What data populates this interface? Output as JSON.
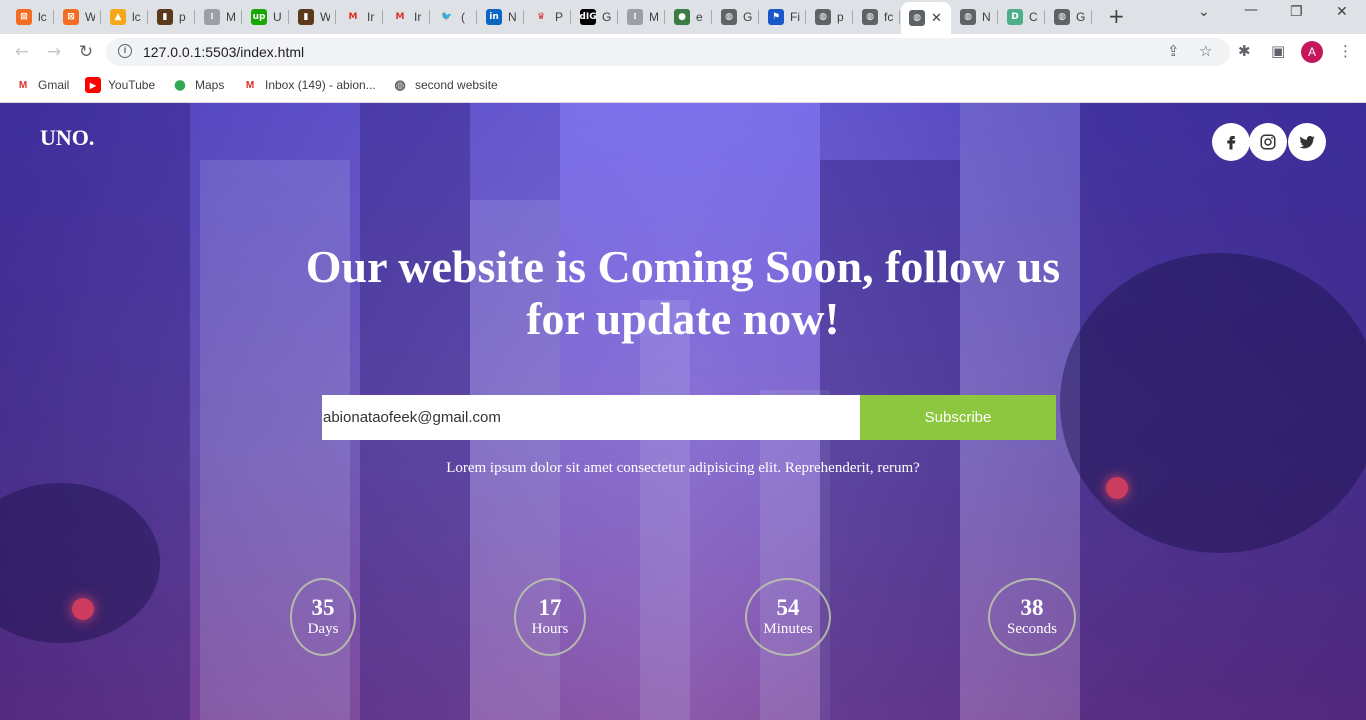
{
  "browser": {
    "tabs": [
      {
        "title": "lc",
        "icon": "xampp-icon",
        "color": "#f26d21",
        "glyph": "⊠"
      },
      {
        "title": "W",
        "icon": "xampp-icon",
        "color": "#f26d21",
        "glyph": "⊠"
      },
      {
        "title": "lc",
        "icon": "phpmyadmin-icon",
        "color": "#f6a81a",
        "glyph": "▲"
      },
      {
        "title": "p",
        "icon": "book-icon",
        "color": "#5a3a1a",
        "glyph": "▮"
      },
      {
        "title": "M",
        "icon": "grid-icon",
        "color": "#9aa0a6",
        "glyph": "⁞"
      },
      {
        "title": "U",
        "icon": "upwork-icon",
        "color": "#14a800",
        "glyph": "up"
      },
      {
        "title": "W",
        "icon": "book-icon",
        "color": "#5a3a1a",
        "glyph": "▮"
      },
      {
        "title": "Ir",
        "icon": "gmail-icon",
        "color": "#ffffff",
        "glyph": "M"
      },
      {
        "title": "Ir",
        "icon": "gmail-icon",
        "color": "#ffffff",
        "glyph": "M"
      },
      {
        "title": "(",
        "icon": "twitter-icon",
        "color": "#ffffff",
        "glyph": "🐦"
      },
      {
        "title": "N",
        "icon": "linkedin-icon",
        "color": "#0a66c2",
        "glyph": "in"
      },
      {
        "title": "P",
        "icon": "premier-league-icon",
        "color": "#ffffff",
        "glyph": "♛"
      },
      {
        "title": "G",
        "icon": "dig-icon",
        "color": "#000000",
        "glyph": "dIG"
      },
      {
        "title": "M",
        "icon": "grid-icon",
        "color": "#9aa0a6",
        "glyph": "⁞"
      },
      {
        "title": "e",
        "icon": "monster-icon",
        "color": "#3a7d44",
        "glyph": "●"
      },
      {
        "title": "G",
        "icon": "globe-icon",
        "color": "#5f6368",
        "glyph": "◍"
      },
      {
        "title": "Fi",
        "icon": "flag-icon",
        "color": "#1a56c7",
        "glyph": "⚑"
      },
      {
        "title": "p",
        "icon": "globe-icon",
        "color": "#5f6368",
        "glyph": "◍"
      },
      {
        "title": "fc",
        "icon": "globe-icon",
        "color": "#5f6368",
        "glyph": "◍"
      },
      {
        "title": "",
        "icon": "globe-icon",
        "color": "#5f6368",
        "glyph": "◍",
        "active": true
      },
      {
        "title": "N",
        "icon": "github-icon",
        "color": "#5f6368",
        "glyph": "◍"
      },
      {
        "title": "C",
        "icon": "d-icon",
        "color": "#4caf8a",
        "glyph": "D"
      },
      {
        "title": "G",
        "icon": "globe-icon",
        "color": "#5f6368",
        "glyph": "◍"
      }
    ],
    "url": "127.0.0.1:5503/index.html",
    "profile_initial": "A",
    "bookmarks": [
      {
        "label": "Gmail",
        "icon": "gmail-icon"
      },
      {
        "label": "YouTube",
        "icon": "youtube-icon"
      },
      {
        "label": "Maps",
        "icon": "maps-icon"
      },
      {
        "label": "Inbox (149) - abion...",
        "icon": "gmail-icon"
      },
      {
        "label": "second website",
        "icon": "globe-icon"
      }
    ]
  },
  "page": {
    "brand": "UNO.",
    "headline": "Our website is Coming Soon, follow us for update now!",
    "email_value": "abionataofeek@gmail.com",
    "subscribe_label": "Subscribe",
    "tagline": "Lorem ipsum dolor sit amet consectetur adipisicing elit. Reprehenderit, rerum?",
    "countdown": [
      {
        "value": "35",
        "label": "Days"
      },
      {
        "value": "17",
        "label": "Hours"
      },
      {
        "value": "54",
        "label": "Minutes"
      },
      {
        "value": "38",
        "label": "Seconds"
      }
    ],
    "colors": {
      "accent": "#8dc63f",
      "overlay": "#4b34d0",
      "text": "#ffffff"
    }
  }
}
